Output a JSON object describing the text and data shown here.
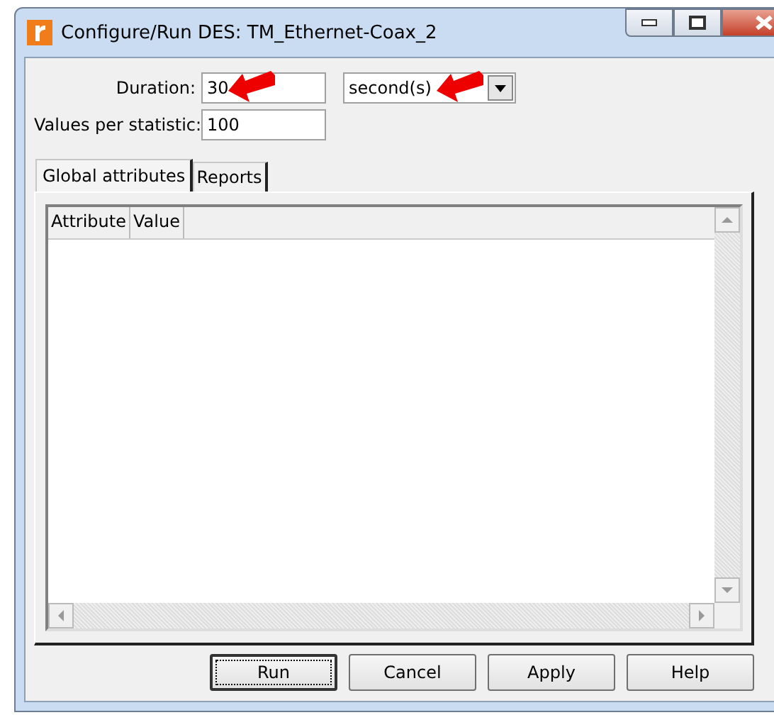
{
  "window": {
    "title": "Configure/Run DES: TM_Ethernet-Coax_2"
  },
  "duration": {
    "label": "Duration:",
    "value": "30",
    "unit": "second(s)"
  },
  "values_per_statistic": {
    "label": "Values per statistic:",
    "value": "100"
  },
  "tabs": [
    {
      "label": "Global attributes",
      "selected": true
    },
    {
      "label": "Reports",
      "selected": false
    }
  ],
  "table": {
    "columns": [
      "Attribute",
      "Value"
    ]
  },
  "buttons": [
    {
      "label": "Run",
      "default": true
    },
    {
      "label": "Cancel",
      "default": false
    },
    {
      "label": "Apply",
      "default": false
    },
    {
      "label": "Help",
      "default": false
    }
  ]
}
